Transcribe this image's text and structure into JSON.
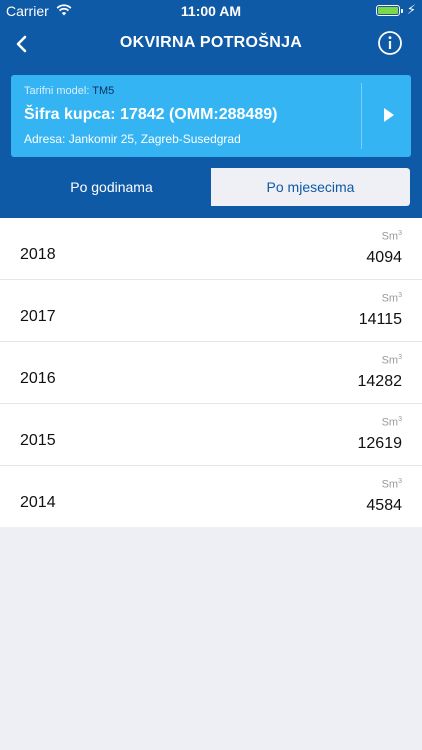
{
  "status_bar": {
    "carrier": "Carrier",
    "time": "11:00 AM"
  },
  "navbar": {
    "title": "OKVIRNA POTROŠNJA"
  },
  "account": {
    "tarif_label": "Tarifni model:",
    "tarif_value": "TM5",
    "sifra": "Šifra kupca: 17842 (OMM:288489)",
    "adresa": "Adresa: Jankomir 25, Zagreb-Susedgrad"
  },
  "tabs": {
    "by_year": "Po godinama",
    "by_month": "Po mjesecima"
  },
  "unit": {
    "base": "Sm",
    "sup": "3"
  },
  "rows": [
    {
      "year": "2018",
      "value": "4094"
    },
    {
      "year": "2017",
      "value": "14115"
    },
    {
      "year": "2016",
      "value": "14282"
    },
    {
      "year": "2015",
      "value": "12619"
    },
    {
      "year": "2014",
      "value": "4584"
    }
  ],
  "colors": {
    "primary": "#0f5aa6",
    "card": "#35b4f4",
    "background": "#eeeff5"
  }
}
